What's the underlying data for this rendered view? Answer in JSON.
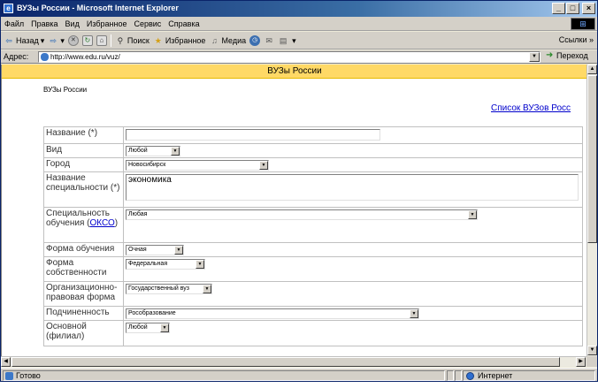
{
  "window": {
    "title": "ВУЗы России - Microsoft Internet Explorer",
    "minimize": "_",
    "maximize": "□",
    "close": "×"
  },
  "menu": [
    {
      "label": "Файл"
    },
    {
      "label": "Правка"
    },
    {
      "label": "Вид"
    },
    {
      "label": "Избранное"
    },
    {
      "label": "Сервис"
    },
    {
      "label": "Справка"
    }
  ],
  "toolbar": {
    "back": "Назад",
    "search": "Поиск",
    "favorites": "Избранное",
    "media": "Медиа",
    "links": "Ссылки »"
  },
  "address": {
    "label": "Адрес:",
    "url": "http://www.edu.ru/vuz/",
    "go": "Переход"
  },
  "page": {
    "header": "ВУЗы России",
    "breadcrumb": "ВУЗы России",
    "list_link": "Список ВУЗов Росс"
  },
  "form": {
    "name_label": "Название (*)",
    "name_value": "",
    "type_label": "Вид",
    "type_value": "Любой",
    "city_label": "Город",
    "city_value": "Новосибирск",
    "spec_name_label": "Название специальности (*)",
    "spec_name_value": "экономика",
    "spec_label_text": "Специальность обучения (",
    "spec_label_link": "ОКСО",
    "spec_label_end": ")",
    "spec_value": "Любая",
    "study_form_label": "Форма обучения",
    "study_form_value": "Очная",
    "ownership_label": "Форма собственности",
    "ownership_value": "Федеральная",
    "legal_form_label": "Организационно-правовая форма",
    "legal_form_value": "Государственный вуз",
    "subordination_label": "Подчиненность",
    "subordination_value": "Рособразование",
    "main_label": "Основной (филиал)",
    "main_value": "Любой"
  },
  "status": {
    "left": "Готово",
    "zone": "Интернет"
  },
  "colors": {
    "header_bg": "#ffd966",
    "link": "#0000cc",
    "titlebar": "#0a246a"
  }
}
